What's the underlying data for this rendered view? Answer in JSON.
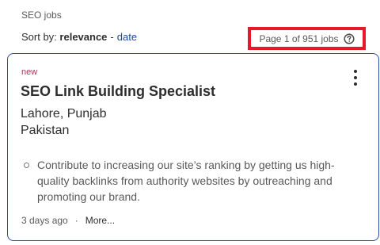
{
  "breadcrumb": "SEO jobs",
  "sort": {
    "label": "Sort by:",
    "active": "relevance",
    "separator": "-",
    "alternative": "date"
  },
  "pagination": {
    "text": "Page 1 of 951 jobs",
    "help_icon": "question-circle-icon"
  },
  "job": {
    "badge": "new",
    "title": "SEO Link Building Specialist",
    "location_line1": "Lahore, Punjab",
    "location_line2": "Pakistan",
    "snippet": "Contribute to increasing our site’s ranking by getting us high-quality backlinks from authority websites by outreaching and promoting our brand.",
    "posted": "3 days ago",
    "dot": "·",
    "more_label": "More...",
    "menu_icon": "vertical-dots-icon"
  },
  "colors": {
    "accent_link": "#1a4ba0",
    "highlight_border": "#e8182b",
    "card_border": "#2c4d9e",
    "new_badge": "#a3385b"
  }
}
